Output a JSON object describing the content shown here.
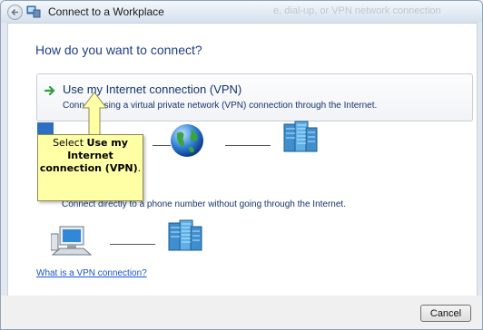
{
  "window": {
    "title": "Connect to a Workplace",
    "title_bg_text": "e, dial-up, or VPN network connection"
  },
  "main": {
    "heading": "How do you want to connect?",
    "option_vpn": {
      "title": "Use my Internet connection (VPN)",
      "description": "Connect using a virtual private network (VPN) connection through the Internet."
    },
    "option_dial": {
      "description": "Connect directly to a phone number without going through the Internet."
    },
    "help_link": "What is a VPN connection?"
  },
  "callout": {
    "prefix": "Select ",
    "bold_text": "Use my Internet connection (VPN)",
    "suffix": "."
  },
  "footer": {
    "cancel_label": "Cancel"
  },
  "icons": {
    "back": "back-arrow-icon",
    "window": "network-icon",
    "option_arrow": "green-arrow-icon",
    "computer": "computer-icon",
    "globe": "globe-icon",
    "server": "server-icon"
  },
  "colors": {
    "heading": "#1e3f85",
    "link": "#1a56c9",
    "callout_bg": "#ffffa6",
    "option_arrow": "#2e9e3a"
  }
}
